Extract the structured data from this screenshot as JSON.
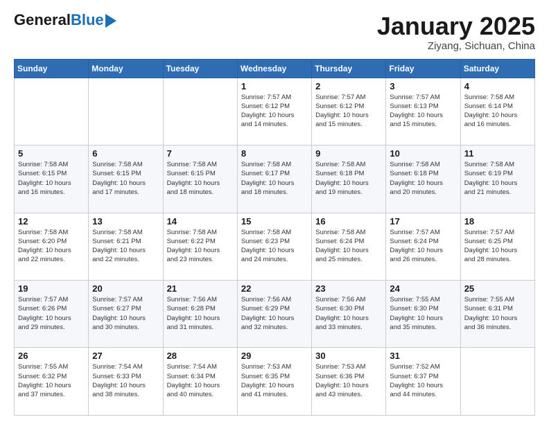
{
  "logo": {
    "general": "General",
    "blue": "Blue"
  },
  "header": {
    "title": "January 2025",
    "location": "Ziyang, Sichuan, China"
  },
  "days_of_week": [
    "Sunday",
    "Monday",
    "Tuesday",
    "Wednesday",
    "Thursday",
    "Friday",
    "Saturday"
  ],
  "weeks": [
    [
      {
        "day": "",
        "info": ""
      },
      {
        "day": "",
        "info": ""
      },
      {
        "day": "",
        "info": ""
      },
      {
        "day": "1",
        "info": "Sunrise: 7:57 AM\nSunset: 6:12 PM\nDaylight: 10 hours\nand 14 minutes."
      },
      {
        "day": "2",
        "info": "Sunrise: 7:57 AM\nSunset: 6:12 PM\nDaylight: 10 hours\nand 15 minutes."
      },
      {
        "day": "3",
        "info": "Sunrise: 7:57 AM\nSunset: 6:13 PM\nDaylight: 10 hours\nand 15 minutes."
      },
      {
        "day": "4",
        "info": "Sunrise: 7:58 AM\nSunset: 6:14 PM\nDaylight: 10 hours\nand 16 minutes."
      }
    ],
    [
      {
        "day": "5",
        "info": "Sunrise: 7:58 AM\nSunset: 6:15 PM\nDaylight: 10 hours\nand 16 minutes."
      },
      {
        "day": "6",
        "info": "Sunrise: 7:58 AM\nSunset: 6:15 PM\nDaylight: 10 hours\nand 17 minutes."
      },
      {
        "day": "7",
        "info": "Sunrise: 7:58 AM\nSunset: 6:15 PM\nDaylight: 10 hours\nand 18 minutes."
      },
      {
        "day": "8",
        "info": "Sunrise: 7:58 AM\nSunset: 6:17 PM\nDaylight: 10 hours\nand 18 minutes."
      },
      {
        "day": "9",
        "info": "Sunrise: 7:58 AM\nSunset: 6:18 PM\nDaylight: 10 hours\nand 19 minutes."
      },
      {
        "day": "10",
        "info": "Sunrise: 7:58 AM\nSunset: 6:18 PM\nDaylight: 10 hours\nand 20 minutes."
      },
      {
        "day": "11",
        "info": "Sunrise: 7:58 AM\nSunset: 6:19 PM\nDaylight: 10 hours\nand 21 minutes."
      }
    ],
    [
      {
        "day": "12",
        "info": "Sunrise: 7:58 AM\nSunset: 6:20 PM\nDaylight: 10 hours\nand 22 minutes."
      },
      {
        "day": "13",
        "info": "Sunrise: 7:58 AM\nSunset: 6:21 PM\nDaylight: 10 hours\nand 22 minutes."
      },
      {
        "day": "14",
        "info": "Sunrise: 7:58 AM\nSunset: 6:22 PM\nDaylight: 10 hours\nand 23 minutes."
      },
      {
        "day": "15",
        "info": "Sunrise: 7:58 AM\nSunset: 6:23 PM\nDaylight: 10 hours\nand 24 minutes."
      },
      {
        "day": "16",
        "info": "Sunrise: 7:58 AM\nSunset: 6:24 PM\nDaylight: 10 hours\nand 25 minutes."
      },
      {
        "day": "17",
        "info": "Sunrise: 7:57 AM\nSunset: 6:24 PM\nDaylight: 10 hours\nand 26 minutes."
      },
      {
        "day": "18",
        "info": "Sunrise: 7:57 AM\nSunset: 6:25 PM\nDaylight: 10 hours\nand 28 minutes."
      }
    ],
    [
      {
        "day": "19",
        "info": "Sunrise: 7:57 AM\nSunset: 6:26 PM\nDaylight: 10 hours\nand 29 minutes."
      },
      {
        "day": "20",
        "info": "Sunrise: 7:57 AM\nSunset: 6:27 PM\nDaylight: 10 hours\nand 30 minutes."
      },
      {
        "day": "21",
        "info": "Sunrise: 7:56 AM\nSunset: 6:28 PM\nDaylight: 10 hours\nand 31 minutes."
      },
      {
        "day": "22",
        "info": "Sunrise: 7:56 AM\nSunset: 6:29 PM\nDaylight: 10 hours\nand 32 minutes."
      },
      {
        "day": "23",
        "info": "Sunrise: 7:56 AM\nSunset: 6:30 PM\nDaylight: 10 hours\nand 33 minutes."
      },
      {
        "day": "24",
        "info": "Sunrise: 7:55 AM\nSunset: 6:30 PM\nDaylight: 10 hours\nand 35 minutes."
      },
      {
        "day": "25",
        "info": "Sunrise: 7:55 AM\nSunset: 6:31 PM\nDaylight: 10 hours\nand 36 minutes."
      }
    ],
    [
      {
        "day": "26",
        "info": "Sunrise: 7:55 AM\nSunset: 6:32 PM\nDaylight: 10 hours\nand 37 minutes."
      },
      {
        "day": "27",
        "info": "Sunrise: 7:54 AM\nSunset: 6:33 PM\nDaylight: 10 hours\nand 38 minutes."
      },
      {
        "day": "28",
        "info": "Sunrise: 7:54 AM\nSunset: 6:34 PM\nDaylight: 10 hours\nand 40 minutes."
      },
      {
        "day": "29",
        "info": "Sunrise: 7:53 AM\nSunset: 6:35 PM\nDaylight: 10 hours\nand 41 minutes."
      },
      {
        "day": "30",
        "info": "Sunrise: 7:53 AM\nSunset: 6:36 PM\nDaylight: 10 hours\nand 43 minutes."
      },
      {
        "day": "31",
        "info": "Sunrise: 7:52 AM\nSunset: 6:37 PM\nDaylight: 10 hours\nand 44 minutes."
      },
      {
        "day": "",
        "info": ""
      }
    ]
  ]
}
